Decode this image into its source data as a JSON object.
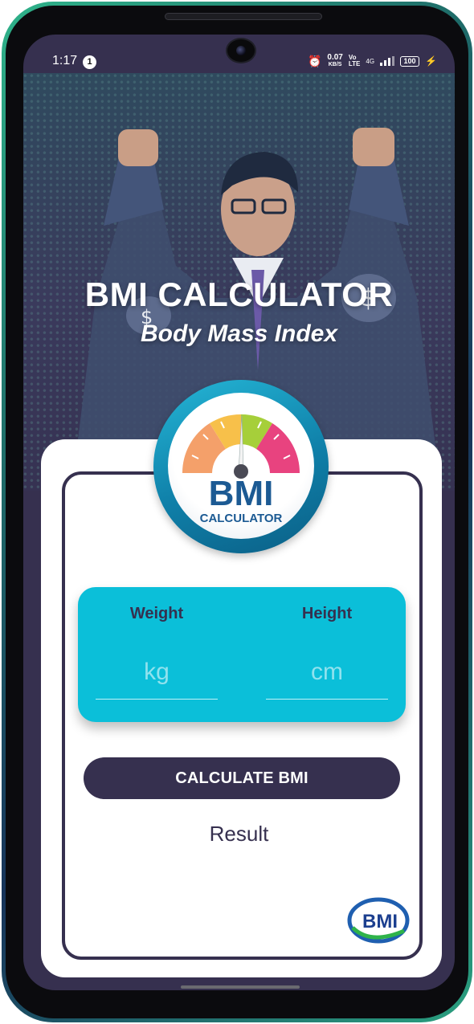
{
  "status_bar": {
    "time": "1:17",
    "notification_count": "1",
    "net_speed_value": "0.07",
    "net_speed_unit": "KB/S",
    "network_type": "4G",
    "battery": "100"
  },
  "hero": {
    "title": "BMI CALCULATOR",
    "subtitle": "Body Mass Index"
  },
  "logo": {
    "word": "BMI",
    "sub": "CALCULATOR"
  },
  "form": {
    "weight_label": "Weight",
    "weight_placeholder": "kg",
    "weight_value": "",
    "height_label": "Height",
    "height_placeholder": "cm",
    "height_value": ""
  },
  "actions": {
    "calculate_label": "CALCULATE BMI"
  },
  "result": {
    "text": "Result"
  },
  "footer_logo": {
    "word": "BMI"
  },
  "colors": {
    "primary": "#36304f",
    "accent": "#0bbfd9",
    "card": "#ffffff"
  }
}
